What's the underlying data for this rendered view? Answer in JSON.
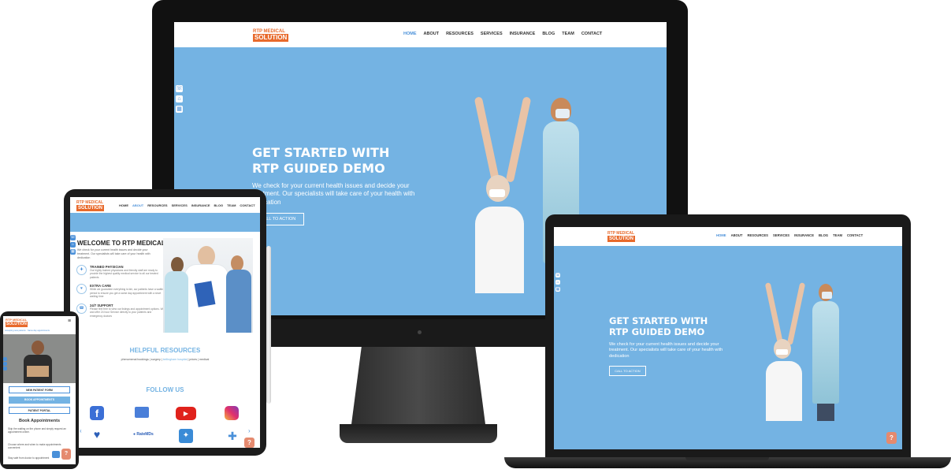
{
  "logo": {
    "line1": "RTP MEDICAL",
    "line2": "SOLUTION"
  },
  "nav": [
    "HOME",
    "ABOUT",
    "RESOURCES",
    "SERVICES",
    "INSURANCE",
    "BLOG",
    "TEAM",
    "CONTACT"
  ],
  "hero": {
    "title1": "GET STARTED WITH",
    "title2": "RTP GUIDED DEMO",
    "desc": "We check for your current health issues and decide your treatment. Our specialists will take care of your health with dedication",
    "cta": "CALL TO ACTION"
  },
  "help_label": "?",
  "tablet": {
    "welcome_title": "WELCOME TO RTP MEDICAL",
    "welcome_text": "We check for your current health issues and decide your treatment. Our specialists will take care of your health with dedication",
    "features": [
      {
        "title": "TRAINED PHYSICIAN",
        "text": "Our highly trained physicians and friendly staff are ready to provide the highest quality medical service to all our treated patients"
      },
      {
        "title": "EXTRA CARE",
        "text": "While we guarantee everything is fair, our patients have a waiting period to ensure you get a same day appointment with a short waiting time"
      },
      {
        "title": "24/7 SUPPORT",
        "text": "Please feel free to view our listings and appointment options. We and offer 24 hour Service directly to your patients and emergency doctors"
      }
    ],
    "resources_title": "HELPFUL RESOURCES",
    "resources_tags": [
      "phenomenal bookings",
      "surgery",
      "bellingham hospital",
      "prices",
      "medical"
    ],
    "follow_title": "FOLLOW US",
    "social": [
      "facebook",
      "google-my-business",
      "youtube",
      "instagram",
      "healthgrades",
      "ratemds",
      "twitter",
      "medical-directory"
    ]
  },
  "phone": {
    "banner": "Accepting new patients · Same day appointments",
    "buttons": [
      "NEW PATIENT FORM",
      "BOOK APPOINTMENTS",
      "PATIENT PORTAL"
    ],
    "book_title": "Book Appointments",
    "book_text": "Skip the waiting on the phone and simply request an appointment online.",
    "list": [
      "Choose where and when to make appointments convenient",
      "Stay safe from doctor to appointment"
    ]
  },
  "colors": {
    "hero": "#74b3e3",
    "accent": "#4a90d9",
    "orange": "#e86a2c",
    "help": "#e58a6f"
  }
}
